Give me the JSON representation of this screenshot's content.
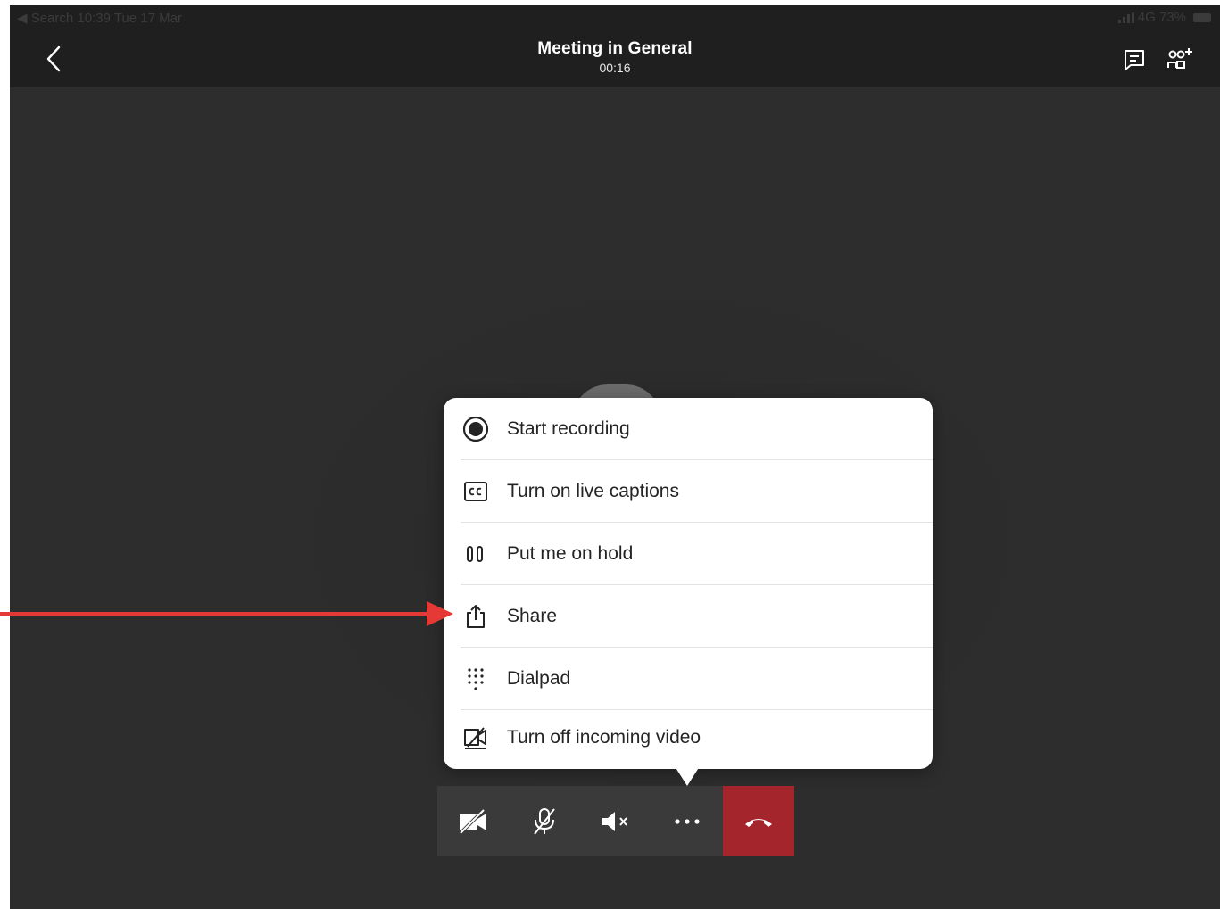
{
  "status_bar": {
    "left_text": "◀ Search  10:39  Tue 17 Mar",
    "right_text": "4G 73%"
  },
  "header": {
    "title": "Meeting in General",
    "timer": "00:16",
    "icons": [
      "back-chevron-icon",
      "chat-icon",
      "add-people-icon"
    ]
  },
  "menu": {
    "items": [
      {
        "label": "Start recording",
        "icon": "record-icon"
      },
      {
        "label": "Turn on live captions",
        "icon": "captions-icon"
      },
      {
        "label": "Put me on hold",
        "icon": "hold-icon"
      },
      {
        "label": "Share",
        "icon": "share-icon"
      },
      {
        "label": "Dialpad",
        "icon": "dialpad-icon"
      },
      {
        "label": "Turn off incoming video",
        "icon": "video-off-icon"
      }
    ]
  },
  "toolbar": {
    "buttons": [
      "camera-off-icon",
      "mic-off-icon",
      "speaker-muted-icon",
      "more-icon",
      "hang-up-icon"
    ]
  },
  "colors": {
    "stage": "#2d2d2d",
    "header": "#1f1f1f",
    "hangup": "#a4262c",
    "annotation_arrow": "#e53935"
  }
}
